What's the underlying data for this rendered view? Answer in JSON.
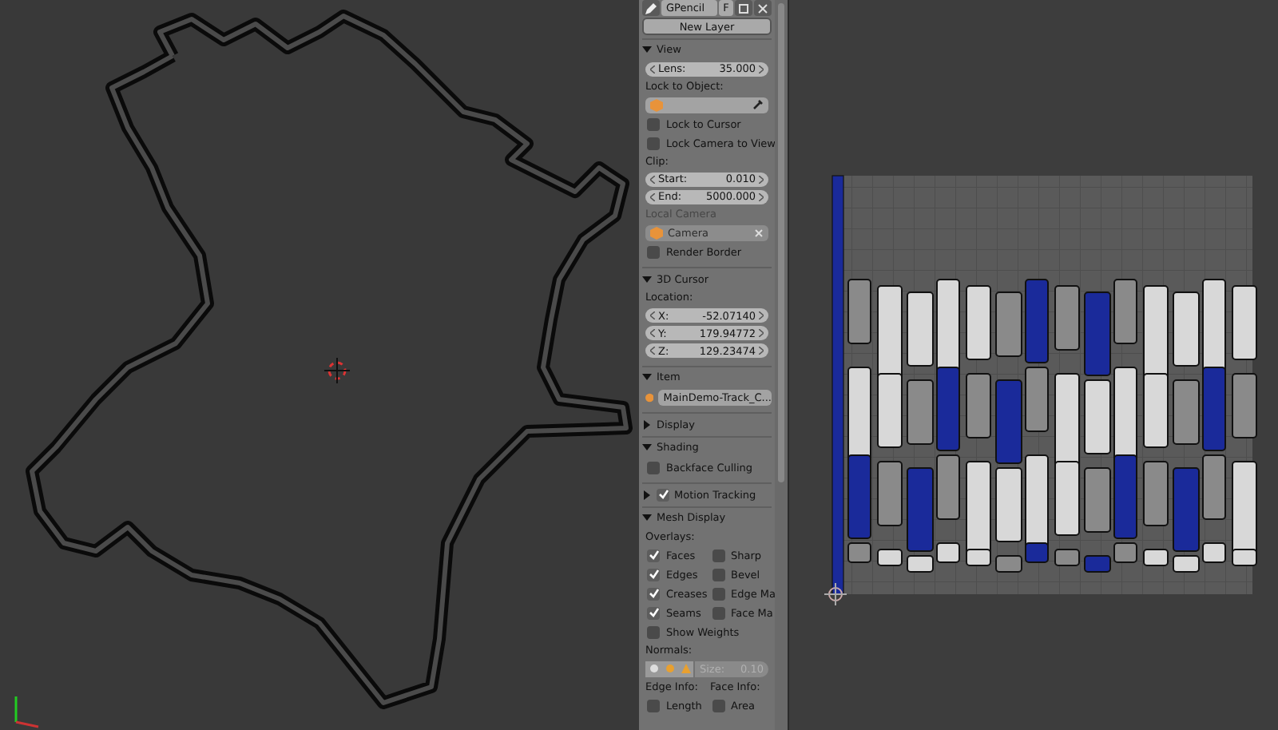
{
  "grease_pencil": {
    "layer_name": "GPencil",
    "fake_user": "F",
    "new_layer": "New Layer"
  },
  "panels": [
    {
      "title": "View",
      "expanded": true,
      "items": [
        {
          "kind": "number",
          "label": "Lens:",
          "value": "35.000"
        },
        {
          "kind": "label",
          "text": "Lock to Object:",
          "disabled": false
        },
        {
          "kind": "object",
          "value": "",
          "disabled": false,
          "eyedropper": true
        },
        {
          "kind": "check",
          "label": "Lock to Cursor",
          "checked": false
        },
        {
          "kind": "check",
          "label": "Lock Camera to View",
          "checked": false
        },
        {
          "kind": "label",
          "text": "Clip:",
          "disabled": false
        },
        {
          "kind": "number",
          "label": "Start:",
          "value": "0.010"
        },
        {
          "kind": "number",
          "label": "End:",
          "value": "5000.000"
        },
        {
          "kind": "label",
          "text": "Local Camera",
          "disabled": true
        },
        {
          "kind": "object",
          "value": "Camera",
          "disabled": true,
          "eyedropper": false
        },
        {
          "kind": "check",
          "label": "Render Border",
          "checked": false
        }
      ]
    },
    {
      "title": "3D Cursor",
      "expanded": true,
      "items": [
        {
          "kind": "label",
          "text": "Location:",
          "disabled": false
        },
        {
          "kind": "number",
          "label": "X:",
          "value": "-52.07140"
        },
        {
          "kind": "number",
          "label": "Y:",
          "value": "179.94772"
        },
        {
          "kind": "number",
          "label": "Z:",
          "value": "129.23474"
        }
      ]
    },
    {
      "title": "Item",
      "expanded": true,
      "items": [
        {
          "kind": "name",
          "value": "MainDemo-Track_C..."
        }
      ]
    },
    {
      "title": "Display",
      "expanded": false
    },
    {
      "title": "Shading",
      "expanded": true,
      "items": [
        {
          "kind": "check",
          "label": "Backface Culling",
          "checked": false
        }
      ]
    },
    {
      "title": "Motion Tracking",
      "expanded": false,
      "header_checked": true
    },
    {
      "title": "Mesh Display",
      "expanded": true,
      "items": [
        {
          "kind": "label",
          "text": "Overlays:",
          "disabled": false
        },
        {
          "kind": "check_pair",
          "left": {
            "label": "Faces",
            "checked": true
          },
          "right": {
            "label": "Sharp",
            "checked": false
          }
        },
        {
          "kind": "check_pair",
          "left": {
            "label": "Edges",
            "checked": true
          },
          "right": {
            "label": "Bevel",
            "checked": false
          }
        },
        {
          "kind": "check_pair",
          "left": {
            "label": "Creases",
            "checked": true
          },
          "right": {
            "label": "Edge Ma",
            "checked": false
          }
        },
        {
          "kind": "check_pair",
          "left": {
            "label": "Seams",
            "checked": true
          },
          "right": {
            "label": "Face Ma",
            "checked": false
          }
        },
        {
          "kind": "check",
          "label": "Show Weights",
          "checked": false
        },
        {
          "kind": "label",
          "text": "Normals:",
          "disabled": false
        },
        {
          "kind": "normals",
          "size_label": "Size:",
          "size_value": "0.10",
          "disabled": true
        },
        {
          "kind": "label_pair",
          "left": "Edge Info:",
          "right": "Face Info:"
        },
        {
          "kind": "check_pair",
          "left": {
            "label": "Length",
            "checked": false
          },
          "right": {
            "label": "Area",
            "checked": false
          }
        }
      ]
    }
  ]
}
